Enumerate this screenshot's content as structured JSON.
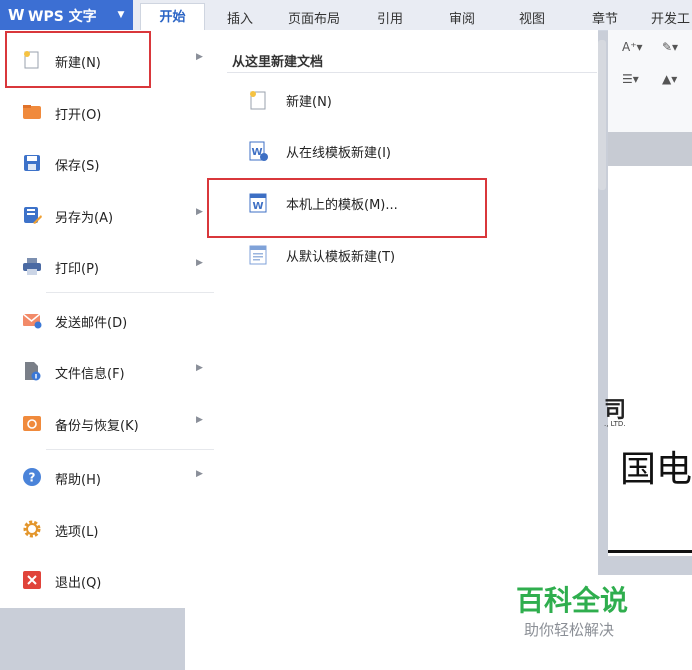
{
  "app": {
    "logo_glyph": "W",
    "title": "WPS 文字",
    "dropdown_glyph": "▼"
  },
  "ribbon_tabs": [
    "开始",
    "插入",
    "页面布局",
    "引用",
    "审阅",
    "视图",
    "章节",
    "开发工"
  ],
  "left_menu": [
    {
      "label": "新建(N)",
      "icon": "new-doc-icon",
      "has_submenu": true
    },
    {
      "label": "打开(O)",
      "icon": "folder-open-icon",
      "has_submenu": false
    },
    {
      "label": "保存(S)",
      "icon": "save-icon",
      "has_submenu": false
    },
    {
      "label": "另存为(A)",
      "icon": "save-as-icon",
      "has_submenu": true
    },
    {
      "label": "打印(P)",
      "icon": "printer-icon",
      "has_submenu": true
    },
    {
      "label": "发送邮件(D)",
      "icon": "mail-icon",
      "has_submenu": false
    },
    {
      "label": "文件信息(F)",
      "icon": "file-info-icon",
      "has_submenu": true
    },
    {
      "label": "备份与恢复(K)",
      "icon": "backup-restore-icon",
      "has_submenu": true
    },
    {
      "label": "帮助(H)",
      "icon": "help-icon",
      "has_submenu": true
    },
    {
      "label": "选项(L)",
      "icon": "gear-icon",
      "has_submenu": false
    },
    {
      "label": "退出(Q)",
      "icon": "exit-icon",
      "has_submenu": false
    }
  ],
  "submenu": {
    "heading": "从这里新建文档",
    "items": [
      {
        "label": "新建(N)",
        "icon": "new-doc-icon"
      },
      {
        "label": "从在线模板新建(I)",
        "icon": "online-template-icon"
      },
      {
        "label": "本机上的模板(M)...",
        "icon": "local-template-icon"
      },
      {
        "label": "从默认模板新建(T)",
        "icon": "default-template-icon"
      }
    ]
  },
  "document": {
    "fragment_1": "司",
    "fragment_2": "., LTD.",
    "fragment_3": "国电"
  },
  "watermark": {
    "title": "百科全说",
    "subtitle": "助你轻松解决"
  },
  "colors": {
    "accent": "#3c6fd3",
    "highlight_box": "#d9373b",
    "watermark_green": "#2fae4e"
  }
}
